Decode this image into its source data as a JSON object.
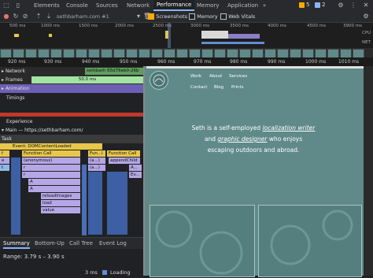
{
  "devtools": {
    "tabs": [
      "Elements",
      "Console",
      "Sources",
      "Network",
      "Performance",
      "Memory",
      "Application",
      "»"
    ],
    "active_tab": "Performance",
    "warnings": "5",
    "errors": "2",
    "url_select": "sethbarham.com #1",
    "screenshots_label": "Screenshots",
    "memory_label": "Memory",
    "webvitals_label": "Web Vitals"
  },
  "overview": {
    "ticks": [
      "500 ms",
      "1000 ms",
      "1500 ms",
      "2000 ms",
      "2500 ms",
      "3000 ms",
      "3500 ms",
      "4000 ms",
      "4500 ms",
      "3900 ms"
    ],
    "side_labels": [
      "CPU",
      "NET"
    ]
  },
  "ruler": {
    "ticks": [
      "920 ms",
      "930 ms",
      "940 ms",
      "950 ms",
      "960 ms",
      "970 ms",
      "980 ms",
      "990 ms",
      "1000 ms",
      "1010 ms"
    ]
  },
  "tracks": {
    "network": "Network",
    "network_request": "sethbarh 65d76eb0-26b",
    "network_left": "",
    "frames": "Frames",
    "frames_value": "50.0 ms",
    "animation": "Animation",
    "timings": "Timings",
    "experience": "Experience",
    "main": "Main — https://sethbarham.com/",
    "task": "Task"
  },
  "flame": {
    "event": "Event: DOMContentLoaded",
    "function_call_1": "Function Call",
    "function_call_2": "Fun...l",
    "function_call_3": "Function Call",
    "f1": "f",
    "e": "e",
    "anonymous": "(anonymous)",
    "a1": "(a...)",
    "append": "appendChild",
    "r": "r",
    "a2": "(a...)",
    "a_dots": "A...",
    "r2": "r",
    "ev": "Ev...",
    "a_label": "A",
    "t": "t",
    "a3": "A",
    "reload": "reloadImages",
    "load": "load",
    "value": "value"
  },
  "bottom": {
    "tabs": [
      "Summary",
      "Bottom-Up",
      "Call Tree",
      "Event Log"
    ],
    "active": "Summary",
    "range": "Range: 3.79 s – 3.90 s",
    "legend_value": "3 ms",
    "legend_label": "Loading"
  },
  "site": {
    "nav_row1": [
      "Work",
      "About",
      "Services"
    ],
    "nav_row2": [
      "Contact",
      "Blog",
      "Prints"
    ],
    "intro_1": "Seth is a self-employed",
    "intro_link1": "localization writer",
    "intro_2": "and",
    "intro_link2": "graphic designer",
    "intro_3": "who enjoys",
    "intro_4": "escaping outdoors and abroad."
  }
}
